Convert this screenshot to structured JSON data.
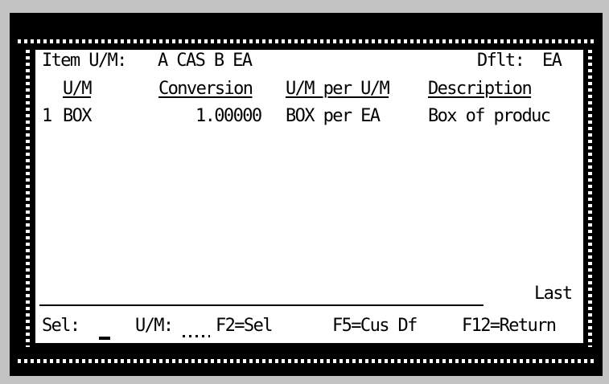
{
  "header": {
    "item_um_label": "Item U/M:",
    "item_um_values": "A CAS B EA",
    "default_label": "Dflt:",
    "default_value": "EA"
  },
  "columns": {
    "um": "U/M",
    "conversion": "Conversion",
    "um_per_um": "U/M per U/M",
    "description": "Description"
  },
  "rows": [
    {
      "line": "1",
      "um": "BOX",
      "conversion": "1.00000",
      "um_per_um": "BOX per EA",
      "description": "Box of produc"
    }
  ],
  "status": {
    "page_indicator": "Last"
  },
  "footer": {
    "sel_label": "Sel:",
    "um_label": "U/M:",
    "f2": "F2=Sel",
    "f5": "F5=Cus Df",
    "f12": "F12=Return"
  }
}
